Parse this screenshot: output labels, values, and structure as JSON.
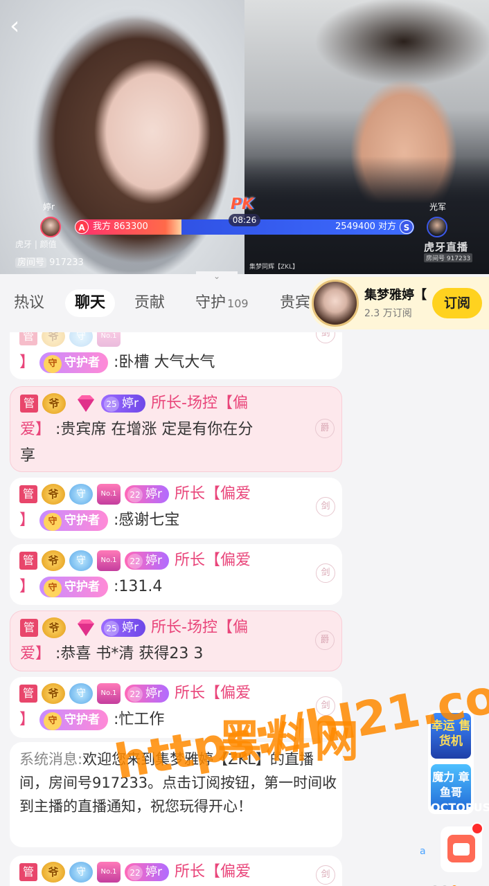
{
  "video": {
    "pk_label": "PK",
    "timer": "08:26",
    "left": {
      "name": "婷r",
      "side_badge": "A",
      "score_label": "我方 863300",
      "watermark": "虎牙 | 颜值",
      "room_label": "房间号",
      "room_no": "917233"
    },
    "right": {
      "name": "光军",
      "side_badge": "S",
      "score_label": "2549400 对方",
      "feed_label": "集梦同辉【ZKL】",
      "watermark": "虎牙直播",
      "watermark_sub": "房间号 917233"
    },
    "left_share": 0.253,
    "fold_icon": "chevron-down-icon"
  },
  "tabs": [
    {
      "label": "热议",
      "count": ""
    },
    {
      "label": "聊天",
      "count": ""
    },
    {
      "label": "贡献",
      "count": ""
    },
    {
      "label": "守护",
      "count": "109"
    },
    {
      "label": "贵宾",
      "count": ""
    }
  ],
  "streamer": {
    "name": "集梦雅婷【",
    "subs": "2.3 万订阅",
    "subscribe_label": "订阅"
  },
  "badges": {
    "admin": "管",
    "ye": "爷",
    "shou": "守",
    "no1": "No.1",
    "guard": "守护者",
    "guard_seal": "守",
    "fan_level_25": "25",
    "fan_level_22": "22",
    "fan_name": "婷r"
  },
  "messages": [
    {
      "nick_tail": "】",
      "text": ":卧槽 大气大气",
      "side": "剑"
    },
    {
      "nick": "所长-场控【偏",
      "nick_tail": "爱】",
      "text": ":贵宾席 在增涨 定是有你在分",
      "text2": "享",
      "side": "爵"
    },
    {
      "nick": "所长【偏爱",
      "nick_tail": "】",
      "text": ":感谢七宝",
      "side": "剑"
    },
    {
      "nick": "所长【偏爱",
      "nick_tail": "】",
      "text": ":131.4",
      "side": "剑"
    },
    {
      "nick": "所长-场控【偏",
      "nick_tail": "爱】",
      "text": ":恭喜 书*清 获得23 3",
      "side": "爵"
    },
    {
      "nick": "所长【偏爱",
      "nick_tail": "】",
      "text": ":忙工作",
      "side": "剑"
    },
    {
      "nick": "所长【偏爱",
      "side": "剑"
    }
  ],
  "system": {
    "label": "系统消息:",
    "text": "欢迎您来到集梦雅婷【ZKL】的直播间，房间号917233。点击订阅按钮，第一时间收到主播的直播通知，祝您玩得开心！"
  },
  "floating": {
    "lucky": "幸运 售货机",
    "octopus": "魔力 章鱼哥 OCTOPUS",
    "side_text": "a"
  },
  "overlay": {
    "line1": "黑料网",
    "line2": "https://hl21.co"
  },
  "colors": {
    "accent": "#ffd21f",
    "pink": "#e9457a",
    "pk_red": "#ff2f6e",
    "pk_blue": "#2a46d9"
  }
}
